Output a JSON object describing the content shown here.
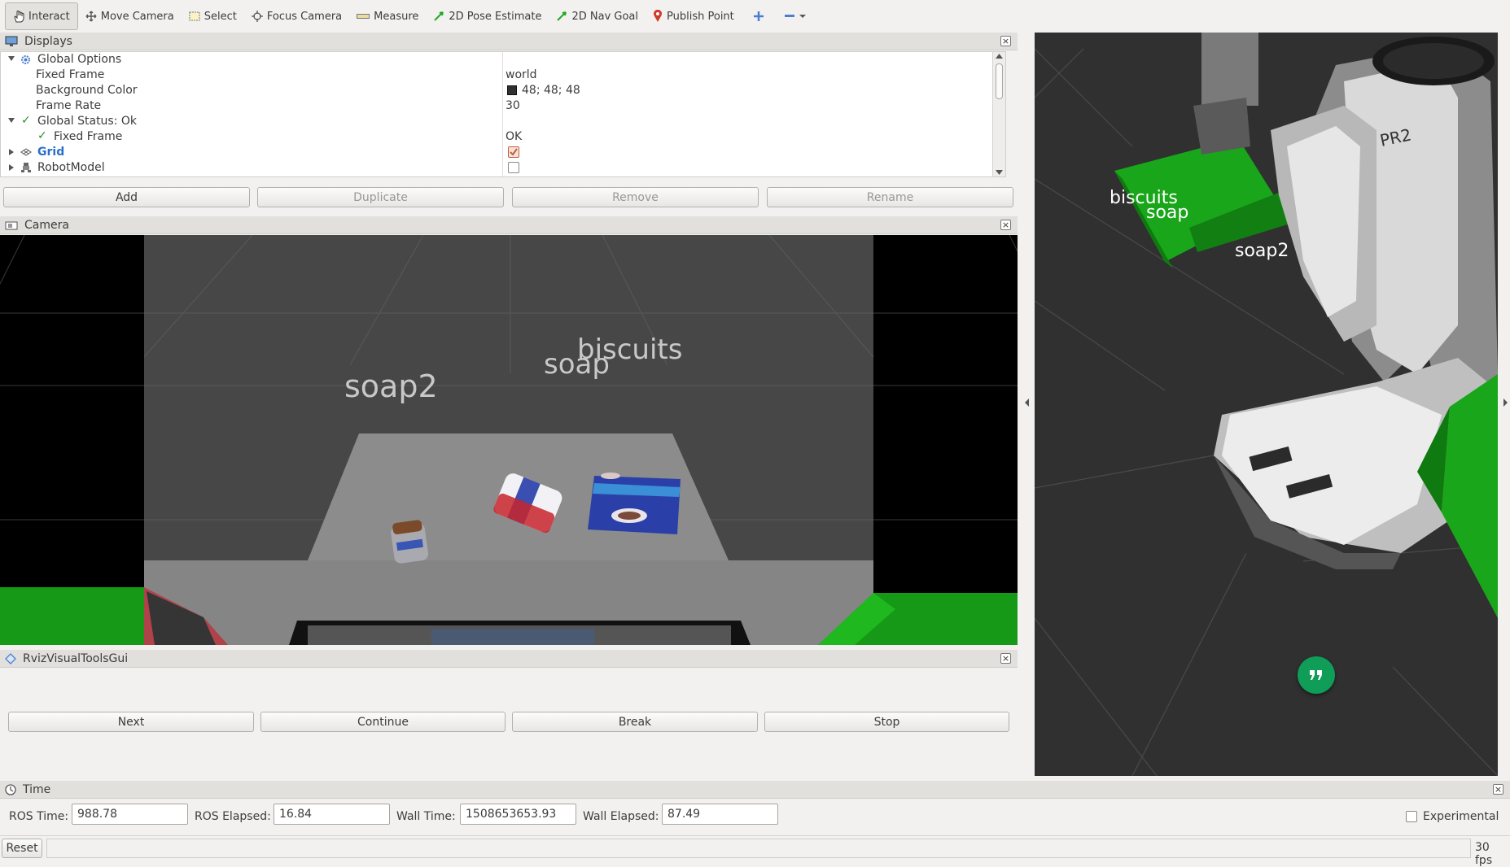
{
  "toolbar": {
    "tools": [
      {
        "label": "Interact",
        "icon": "hand-icon",
        "active": true
      },
      {
        "label": "Move Camera",
        "icon": "move-camera-icon"
      },
      {
        "label": "Select",
        "icon": "select-icon"
      },
      {
        "label": "Focus Camera",
        "icon": "focus-camera-icon"
      },
      {
        "label": "Measure",
        "icon": "ruler-icon"
      },
      {
        "label": "2D Pose Estimate",
        "icon": "green-arrow-icon"
      },
      {
        "label": "2D Nav Goal",
        "icon": "green-arrow-icon"
      },
      {
        "label": "Publish Point",
        "icon": "map-pin-icon"
      }
    ]
  },
  "displays": {
    "title": "Displays",
    "rows": [
      {
        "label": "Global Options",
        "value": ""
      },
      {
        "label": "Fixed Frame",
        "value": "world"
      },
      {
        "label": "Background Color",
        "value": "48; 48; 48"
      },
      {
        "label": "Frame Rate",
        "value": "30"
      },
      {
        "label": "Global Status: Ok",
        "value": ""
      },
      {
        "label": "Fixed Frame",
        "value": "OK"
      },
      {
        "label": "Grid",
        "value": ""
      },
      {
        "label": "RobotModel",
        "value": ""
      }
    ],
    "grid_enabled": true,
    "robotmodel_enabled": false,
    "buttons": {
      "add": "Add",
      "duplicate": "Duplicate",
      "remove": "Remove",
      "rename": "Rename"
    }
  },
  "camera": {
    "title": "Camera",
    "labels": {
      "soap2": "soap2",
      "soap": "soap",
      "biscuits": "biscuits"
    }
  },
  "view3d": {
    "labels": {
      "biscuits": "biscuits",
      "soap": "soap",
      "soap2": "soap2"
    },
    "robot_text": "PR2"
  },
  "rviz_tools": {
    "title": "RvizVisualToolsGui",
    "buttons": {
      "next": "Next",
      "continue": "Continue",
      "break": "Break",
      "stop": "Stop"
    }
  },
  "time": {
    "title": "Time",
    "ros_time_label": "ROS Time:",
    "ros_time": "988.78",
    "ros_elapsed_label": "ROS Elapsed:",
    "ros_elapsed": "16.84",
    "wall_time_label": "Wall Time:",
    "wall_time": "1508653653.93",
    "wall_elapsed_label": "Wall Elapsed:",
    "wall_elapsed": "87.49",
    "experimental_label": "Experimental"
  },
  "status": {
    "reset": "Reset",
    "fps": "30 fps"
  },
  "colors": {
    "background": "#303030",
    "accent_green": "#22aa22",
    "hangouts_green": "#0f9d58"
  }
}
